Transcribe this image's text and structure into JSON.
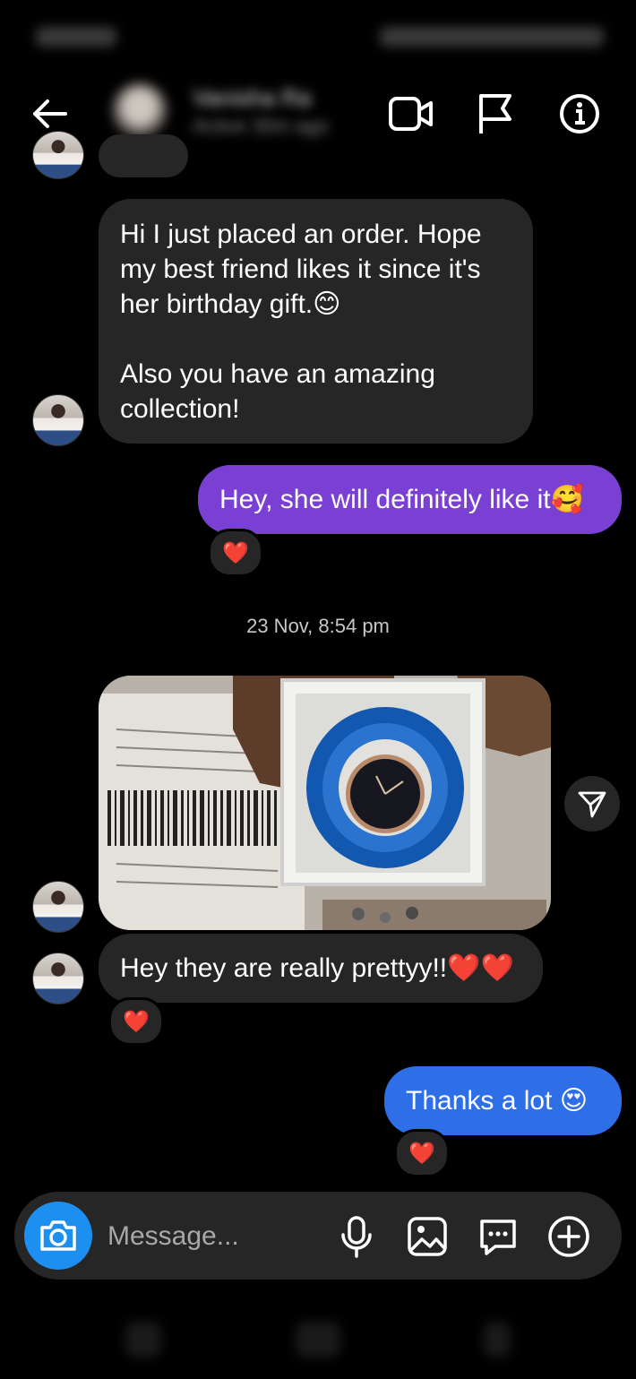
{
  "header": {
    "contact_name": "Vanisha Ra",
    "status": "Active 30m ago"
  },
  "messages": {
    "m1": {
      "line1": "Hi I just placed an order. Hope",
      "line2": "my best friend likes it since it's",
      "line3": "her birthday gift.",
      "emoji": "😊",
      "line4": "Also you have an amazing",
      "line5": "collection!"
    },
    "m2": {
      "text": "Hey, she will definitely like it",
      "emoji": "🥰",
      "reaction": "❤️"
    },
    "timestamp": "23 Nov, 8:54 pm",
    "m3": {
      "text": "Hey they are really prettyy!!",
      "emoji": "❤️❤️",
      "reaction": "❤️"
    },
    "m4": {
      "text": "Thanks a lot",
      "emoji": "😍",
      "reaction": "❤️"
    }
  },
  "composer": {
    "placeholder": "Message..."
  },
  "icons": {
    "back": "arrow-left-icon",
    "video": "video-call-icon",
    "flag": "flag-icon",
    "info": "info-icon",
    "camera": "camera-icon",
    "mic": "microphone-icon",
    "gallery": "image-icon",
    "sticker": "chat-bubble-icon",
    "add": "plus-circle-icon",
    "share": "send-icon"
  },
  "colors": {
    "background": "#000000",
    "incoming_bubble": "#262626",
    "outgoing_purple": "#7a3fd3",
    "outgoing_blue": "#2e6ee6",
    "camera_button": "#1d8ff0",
    "reaction_heart": "#ff2a3d"
  }
}
